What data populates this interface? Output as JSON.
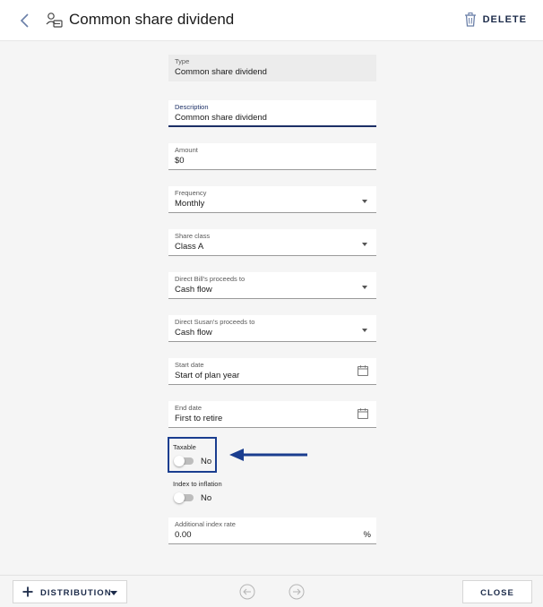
{
  "header": {
    "title": "Common share dividend",
    "delete_label": "DELETE"
  },
  "form": {
    "type": {
      "label": "Type",
      "value": "Common share dividend"
    },
    "description": {
      "label": "Description",
      "value": "Common share dividend"
    },
    "amount": {
      "label": "Amount",
      "value": "$0"
    },
    "frequency": {
      "label": "Frequency",
      "value": "Monthly"
    },
    "share_class": {
      "label": "Share class",
      "value": "Class A"
    },
    "bill_proceeds": {
      "label": "Direct Bill's proceeds to",
      "value": "Cash flow"
    },
    "susan_proceeds": {
      "label": "Direct Susan's proceeds to",
      "value": "Cash flow"
    },
    "start_date": {
      "label": "Start date",
      "value": "Start of plan year"
    },
    "end_date": {
      "label": "End date",
      "value": "First to retire"
    },
    "taxable": {
      "label": "Taxable",
      "value": "No"
    },
    "index_to_inflation": {
      "label": "Index to inflation",
      "value": "No"
    },
    "additional_index_rate": {
      "label": "Additional index rate",
      "value": "0.00",
      "unit": "%"
    }
  },
  "footer": {
    "distribution_label": "DISTRIBUTION",
    "close_label": "CLOSE"
  },
  "colors": {
    "accent_navy": "#1c2b4a",
    "focus_underline": "#1c2f66",
    "annotation_blue": "#1a3d8f"
  },
  "icons": [
    "back-arrow-icon",
    "dividend-icon",
    "trash-icon",
    "chevron-down-icon",
    "calendar-icon",
    "plus-icon",
    "arrow-left-circle-icon",
    "arrow-right-circle-icon",
    "annotation-arrow-icon"
  ]
}
